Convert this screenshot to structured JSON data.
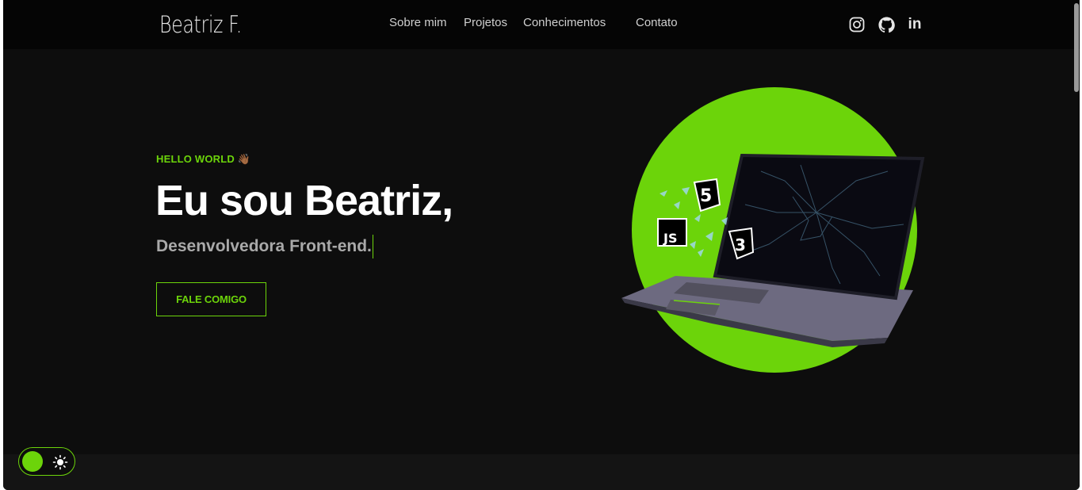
{
  "header": {
    "logo": "Beatriz F.",
    "nav": [
      "Sobre mim",
      "Projetos",
      "Conhecimentos",
      "Contato"
    ],
    "social": [
      {
        "name": "instagram-icon"
      },
      {
        "name": "github-icon"
      },
      {
        "name": "linkedin-icon",
        "text": "in"
      }
    ]
  },
  "hero": {
    "greeting": "HELLO WORLD 👋🏾",
    "headline": "Eu sou Beatriz,",
    "subtitle": "Desenvolvedora Front-end.",
    "cta": "FALE COMIGO",
    "image_badges": [
      "5",
      "JS",
      "3"
    ]
  },
  "theme_toggle": {
    "icon": "sun-icon",
    "state": "dark"
  },
  "colors": {
    "accent": "#6cd40a",
    "background": "#0d0d0d",
    "navbar": "#050505",
    "text": "#ffffff",
    "muted": "#a9a9a9"
  }
}
